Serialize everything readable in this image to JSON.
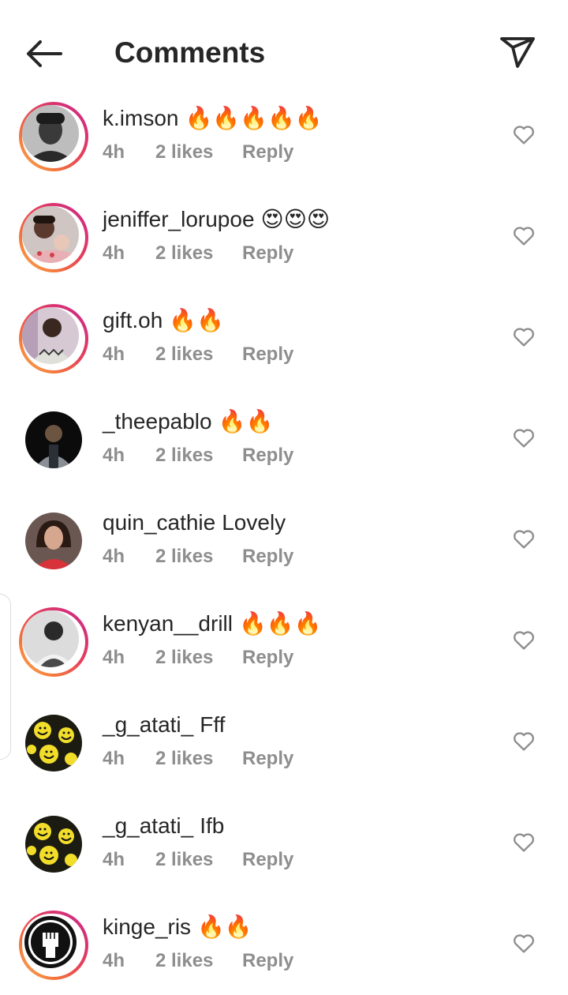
{
  "header": {
    "title": "Comments"
  },
  "comments": [
    {
      "username": "k.imson",
      "text": "🔥🔥🔥🔥🔥",
      "time": "4h",
      "likes": "2 likes",
      "reply": "Reply",
      "story_ring": true,
      "avatar": "bw-portrait"
    },
    {
      "username": "jeniffer_lorupoe",
      "text": "😍😍😍",
      "time": "4h",
      "likes": "2 likes",
      "reply": "Reply",
      "story_ring": true,
      "avatar": "woman-baby-portrait"
    },
    {
      "username": "gift.oh",
      "text": "🔥🔥",
      "time": "4h",
      "likes": "2 likes",
      "reply": "Reply",
      "story_ring": true,
      "avatar": "man-patterned-shirt"
    },
    {
      "username": "_theepablo",
      "text": "🔥🔥",
      "time": "4h",
      "likes": "2 likes",
      "reply": "Reply",
      "story_ring": false,
      "avatar": "man-dark-background"
    },
    {
      "username": "quin_cathie",
      "text": "Lovely",
      "time": "4h",
      "likes": "2 likes",
      "reply": "Reply",
      "story_ring": false,
      "avatar": "woman-portrait"
    },
    {
      "username": "kenyan__drill",
      "text": "🔥🔥🔥",
      "time": "4h",
      "likes": "2 likes",
      "reply": "Reply",
      "story_ring": true,
      "avatar": "bw-man-portrait"
    },
    {
      "username": "_g_atati_",
      "text": "Fff",
      "time": "4h",
      "likes": "2 likes",
      "reply": "Reply",
      "story_ring": false,
      "avatar": "yellow-smiley-pattern"
    },
    {
      "username": "_g_atati_",
      "text": "Ifb",
      "time": "4h",
      "likes": "2 likes",
      "reply": "Reply",
      "story_ring": false,
      "avatar": "yellow-smiley-pattern"
    },
    {
      "username": "kinge_ris",
      "text": "🔥🔥",
      "time": "4h",
      "likes": "2 likes",
      "reply": "Reply",
      "story_ring": true,
      "avatar": "raised-fist-logo"
    }
  ],
  "icons": {
    "back": "arrow-left-icon",
    "share": "paper-plane-icon",
    "like": "heart-outline-icon"
  },
  "colors": {
    "text": "#262626",
    "muted": "#8e8e8e",
    "story_ring_start": "#c8258f",
    "story_ring_end": "#fcb45c"
  }
}
